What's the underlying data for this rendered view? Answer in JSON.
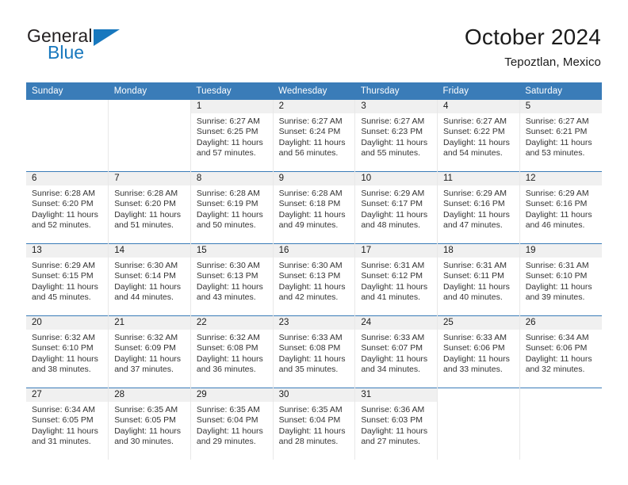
{
  "logo": {
    "word_top": "General",
    "word_bottom": "Blue",
    "triangle": "triangle-icon",
    "accent_color": "#1878be"
  },
  "header": {
    "title": "October 2024",
    "subtitle": "Tepoztlan, Mexico"
  },
  "theme": {
    "header_blue": "#3a7cb8",
    "daynum_band": "#f0f0f0",
    "text": "#333333"
  },
  "calendar": {
    "weekday_headers": [
      "Sunday",
      "Monday",
      "Tuesday",
      "Wednesday",
      "Thursday",
      "Friday",
      "Saturday"
    ],
    "weeks": [
      [
        {
          "day": "",
          "lines": []
        },
        {
          "day": "",
          "lines": []
        },
        {
          "day": "1",
          "lines": [
            "Sunrise: 6:27 AM",
            "Sunset: 6:25 PM",
            "Daylight: 11 hours",
            "and 57 minutes."
          ]
        },
        {
          "day": "2",
          "lines": [
            "Sunrise: 6:27 AM",
            "Sunset: 6:24 PM",
            "Daylight: 11 hours",
            "and 56 minutes."
          ]
        },
        {
          "day": "3",
          "lines": [
            "Sunrise: 6:27 AM",
            "Sunset: 6:23 PM",
            "Daylight: 11 hours",
            "and 55 minutes."
          ]
        },
        {
          "day": "4",
          "lines": [
            "Sunrise: 6:27 AM",
            "Sunset: 6:22 PM",
            "Daylight: 11 hours",
            "and 54 minutes."
          ]
        },
        {
          "day": "5",
          "lines": [
            "Sunrise: 6:27 AM",
            "Sunset: 6:21 PM",
            "Daylight: 11 hours",
            "and 53 minutes."
          ]
        }
      ],
      [
        {
          "day": "6",
          "lines": [
            "Sunrise: 6:28 AM",
            "Sunset: 6:20 PM",
            "Daylight: 11 hours",
            "and 52 minutes."
          ]
        },
        {
          "day": "7",
          "lines": [
            "Sunrise: 6:28 AM",
            "Sunset: 6:20 PM",
            "Daylight: 11 hours",
            "and 51 minutes."
          ]
        },
        {
          "day": "8",
          "lines": [
            "Sunrise: 6:28 AM",
            "Sunset: 6:19 PM",
            "Daylight: 11 hours",
            "and 50 minutes."
          ]
        },
        {
          "day": "9",
          "lines": [
            "Sunrise: 6:28 AM",
            "Sunset: 6:18 PM",
            "Daylight: 11 hours",
            "and 49 minutes."
          ]
        },
        {
          "day": "10",
          "lines": [
            "Sunrise: 6:29 AM",
            "Sunset: 6:17 PM",
            "Daylight: 11 hours",
            "and 48 minutes."
          ]
        },
        {
          "day": "11",
          "lines": [
            "Sunrise: 6:29 AM",
            "Sunset: 6:16 PM",
            "Daylight: 11 hours",
            "and 47 minutes."
          ]
        },
        {
          "day": "12",
          "lines": [
            "Sunrise: 6:29 AM",
            "Sunset: 6:16 PM",
            "Daylight: 11 hours",
            "and 46 minutes."
          ]
        }
      ],
      [
        {
          "day": "13",
          "lines": [
            "Sunrise: 6:29 AM",
            "Sunset: 6:15 PM",
            "Daylight: 11 hours",
            "and 45 minutes."
          ]
        },
        {
          "day": "14",
          "lines": [
            "Sunrise: 6:30 AM",
            "Sunset: 6:14 PM",
            "Daylight: 11 hours",
            "and 44 minutes."
          ]
        },
        {
          "day": "15",
          "lines": [
            "Sunrise: 6:30 AM",
            "Sunset: 6:13 PM",
            "Daylight: 11 hours",
            "and 43 minutes."
          ]
        },
        {
          "day": "16",
          "lines": [
            "Sunrise: 6:30 AM",
            "Sunset: 6:13 PM",
            "Daylight: 11 hours",
            "and 42 minutes."
          ]
        },
        {
          "day": "17",
          "lines": [
            "Sunrise: 6:31 AM",
            "Sunset: 6:12 PM",
            "Daylight: 11 hours",
            "and 41 minutes."
          ]
        },
        {
          "day": "18",
          "lines": [
            "Sunrise: 6:31 AM",
            "Sunset: 6:11 PM",
            "Daylight: 11 hours",
            "and 40 minutes."
          ]
        },
        {
          "day": "19",
          "lines": [
            "Sunrise: 6:31 AM",
            "Sunset: 6:10 PM",
            "Daylight: 11 hours",
            "and 39 minutes."
          ]
        }
      ],
      [
        {
          "day": "20",
          "lines": [
            "Sunrise: 6:32 AM",
            "Sunset: 6:10 PM",
            "Daylight: 11 hours",
            "and 38 minutes."
          ]
        },
        {
          "day": "21",
          "lines": [
            "Sunrise: 6:32 AM",
            "Sunset: 6:09 PM",
            "Daylight: 11 hours",
            "and 37 minutes."
          ]
        },
        {
          "day": "22",
          "lines": [
            "Sunrise: 6:32 AM",
            "Sunset: 6:08 PM",
            "Daylight: 11 hours",
            "and 36 minutes."
          ]
        },
        {
          "day": "23",
          "lines": [
            "Sunrise: 6:33 AM",
            "Sunset: 6:08 PM",
            "Daylight: 11 hours",
            "and 35 minutes."
          ]
        },
        {
          "day": "24",
          "lines": [
            "Sunrise: 6:33 AM",
            "Sunset: 6:07 PM",
            "Daylight: 11 hours",
            "and 34 minutes."
          ]
        },
        {
          "day": "25",
          "lines": [
            "Sunrise: 6:33 AM",
            "Sunset: 6:06 PM",
            "Daylight: 11 hours",
            "and 33 minutes."
          ]
        },
        {
          "day": "26",
          "lines": [
            "Sunrise: 6:34 AM",
            "Sunset: 6:06 PM",
            "Daylight: 11 hours",
            "and 32 minutes."
          ]
        }
      ],
      [
        {
          "day": "27",
          "lines": [
            "Sunrise: 6:34 AM",
            "Sunset: 6:05 PM",
            "Daylight: 11 hours",
            "and 31 minutes."
          ]
        },
        {
          "day": "28",
          "lines": [
            "Sunrise: 6:35 AM",
            "Sunset: 6:05 PM",
            "Daylight: 11 hours",
            "and 30 minutes."
          ]
        },
        {
          "day": "29",
          "lines": [
            "Sunrise: 6:35 AM",
            "Sunset: 6:04 PM",
            "Daylight: 11 hours",
            "and 29 minutes."
          ]
        },
        {
          "day": "30",
          "lines": [
            "Sunrise: 6:35 AM",
            "Sunset: 6:04 PM",
            "Daylight: 11 hours",
            "and 28 minutes."
          ]
        },
        {
          "day": "31",
          "lines": [
            "Sunrise: 6:36 AM",
            "Sunset: 6:03 PM",
            "Daylight: 11 hours",
            "and 27 minutes."
          ]
        },
        {
          "day": "",
          "lines": []
        },
        {
          "day": "",
          "lines": []
        }
      ]
    ]
  }
}
